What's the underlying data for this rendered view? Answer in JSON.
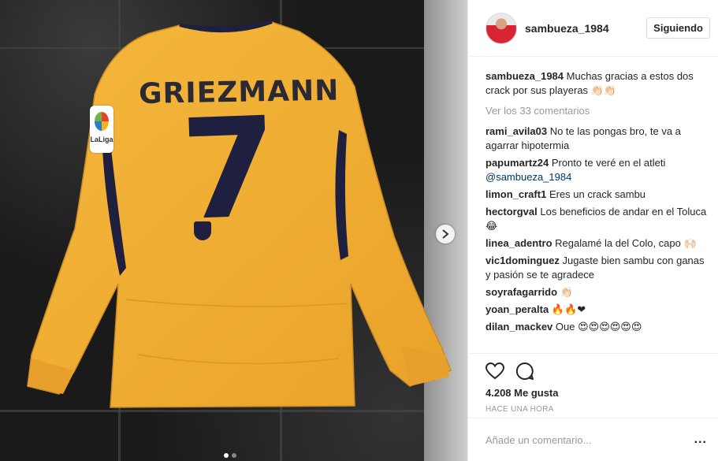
{
  "post": {
    "username": "sambueza_1984",
    "follow_label": "Siguiendo",
    "caption_text": "Muchas gracias a estos dos crack por sus playeras 👏🏻👏🏻",
    "view_all_comments": "Ver los 33 comentarios",
    "likes": "4.208 Me gusta",
    "time": "HACE UNA HORA",
    "comment_placeholder": "Añade un comentario...",
    "more_label": "..."
  },
  "photo": {
    "jersey_name": "GRIEZMANN",
    "jersey_number": "7",
    "badge_text": "LaLiga",
    "carousel_dots": 2,
    "carousel_active": 0
  },
  "comments": [
    {
      "user": "rami_avila03",
      "text": "No te las pongas bro, te va a agarrar hipotermia"
    },
    {
      "user": "papumartz24",
      "text": "Pronto te veré en el atleti",
      "mention": "@sambueza_1984"
    },
    {
      "user": "limon_craft1",
      "text": "Eres un crack sambu"
    },
    {
      "user": "hectorgval",
      "text": "Los beneficios de andar en el Toluca 😂"
    },
    {
      "user": "linea_adentro",
      "text": "Regalamé la del Colo, capo 🙌🏻"
    },
    {
      "user": "vic1dominguez",
      "text": "Jugaste bien sambu con ganas y pasión se te agradece"
    },
    {
      "user": "soyrafagarrido",
      "text": "👏🏻"
    },
    {
      "user": "yoan_peralta",
      "text": "🔥🔥❤"
    },
    {
      "user": "dilan_mackev",
      "text": "Oue 😍😍😍😍😍😍"
    }
  ],
  "colors": {
    "shirt": "#f2b134",
    "shirt_shadow": "#d9962a",
    "navy": "#1f2040",
    "mention": "#003569",
    "muted": "#999999"
  },
  "icons": [
    "heart-icon",
    "comment-icon",
    "chevron-right-icon"
  ]
}
